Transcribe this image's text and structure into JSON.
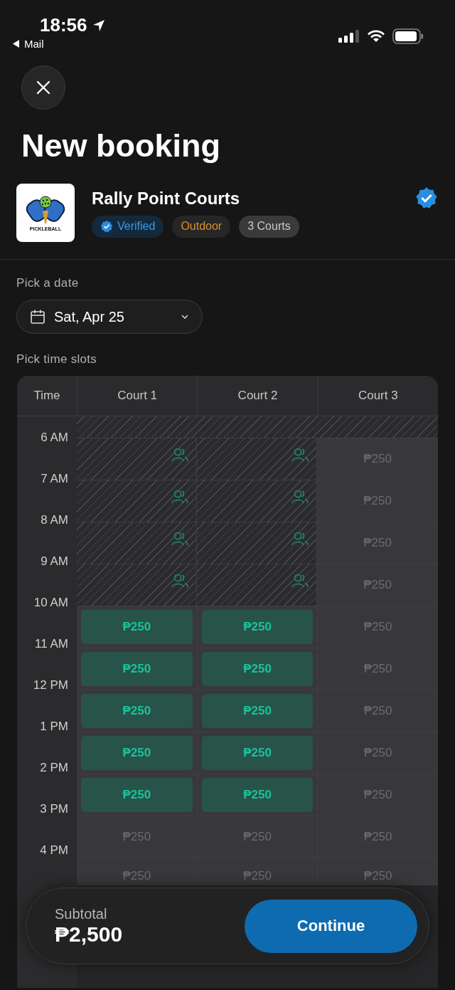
{
  "status_bar": {
    "time": "18:56",
    "back_label": "Mail"
  },
  "title": "New booking",
  "venue": {
    "name": "Rally Point Courts",
    "logo_text": "PICKLEBALL",
    "verified": true,
    "tags": [
      {
        "label": "Verified",
        "kind": "verified"
      },
      {
        "label": "Outdoor",
        "kind": "outdoor"
      },
      {
        "label": "3 Courts",
        "kind": "count"
      }
    ]
  },
  "date_section": {
    "label": "Pick a date",
    "value": "Sat, Apr 25"
  },
  "slots_section": {
    "label": "Pick time slots",
    "time_header": "Time",
    "court_headers": [
      "Court 1",
      "Court 2",
      "Court 3"
    ],
    "times": [
      "6 AM",
      "7 AM",
      "8 AM",
      "9 AM",
      "10 AM",
      "11 AM",
      "12 PM",
      "1 PM",
      "2 PM",
      "3 PM",
      "4 PM"
    ],
    "rows": [
      [
        {
          "kind": "booked"
        },
        {
          "kind": "booked"
        },
        {
          "kind": "open",
          "price": "₱250",
          "selected": false
        }
      ],
      [
        {
          "kind": "booked"
        },
        {
          "kind": "booked"
        },
        {
          "kind": "open",
          "price": "₱250",
          "selected": false
        }
      ],
      [
        {
          "kind": "booked"
        },
        {
          "kind": "booked"
        },
        {
          "kind": "open",
          "price": "₱250",
          "selected": false
        }
      ],
      [
        {
          "kind": "booked"
        },
        {
          "kind": "booked"
        },
        {
          "kind": "open",
          "price": "₱250",
          "selected": false
        }
      ],
      [
        {
          "kind": "open",
          "price": "₱250",
          "selected": true
        },
        {
          "kind": "open",
          "price": "₱250",
          "selected": true
        },
        {
          "kind": "open",
          "price": "₱250",
          "selected": false
        }
      ],
      [
        {
          "kind": "open",
          "price": "₱250",
          "selected": true
        },
        {
          "kind": "open",
          "price": "₱250",
          "selected": true
        },
        {
          "kind": "open",
          "price": "₱250",
          "selected": false
        }
      ],
      [
        {
          "kind": "open",
          "price": "₱250",
          "selected": true
        },
        {
          "kind": "open",
          "price": "₱250",
          "selected": true
        },
        {
          "kind": "open",
          "price": "₱250",
          "selected": false
        }
      ],
      [
        {
          "kind": "open",
          "price": "₱250",
          "selected": true
        },
        {
          "kind": "open",
          "price": "₱250",
          "selected": true
        },
        {
          "kind": "open",
          "price": "₱250",
          "selected": false
        }
      ],
      [
        {
          "kind": "open",
          "price": "₱250",
          "selected": true
        },
        {
          "kind": "open",
          "price": "₱250",
          "selected": true
        },
        {
          "kind": "open",
          "price": "₱250",
          "selected": false
        }
      ],
      [
        {
          "kind": "open",
          "price": "₱250",
          "selected": false
        },
        {
          "kind": "open",
          "price": "₱250",
          "selected": false
        },
        {
          "kind": "open",
          "price": "₱250",
          "selected": false
        }
      ],
      [
        {
          "kind": "open",
          "price": "₱250",
          "selected": false
        },
        {
          "kind": "open",
          "price": "₱250",
          "selected": false
        },
        {
          "kind": "open",
          "price": "₱250",
          "selected": false
        }
      ]
    ]
  },
  "footer": {
    "subtotal_label": "Subtotal",
    "subtotal": "₱2,500",
    "button": "Continue"
  }
}
